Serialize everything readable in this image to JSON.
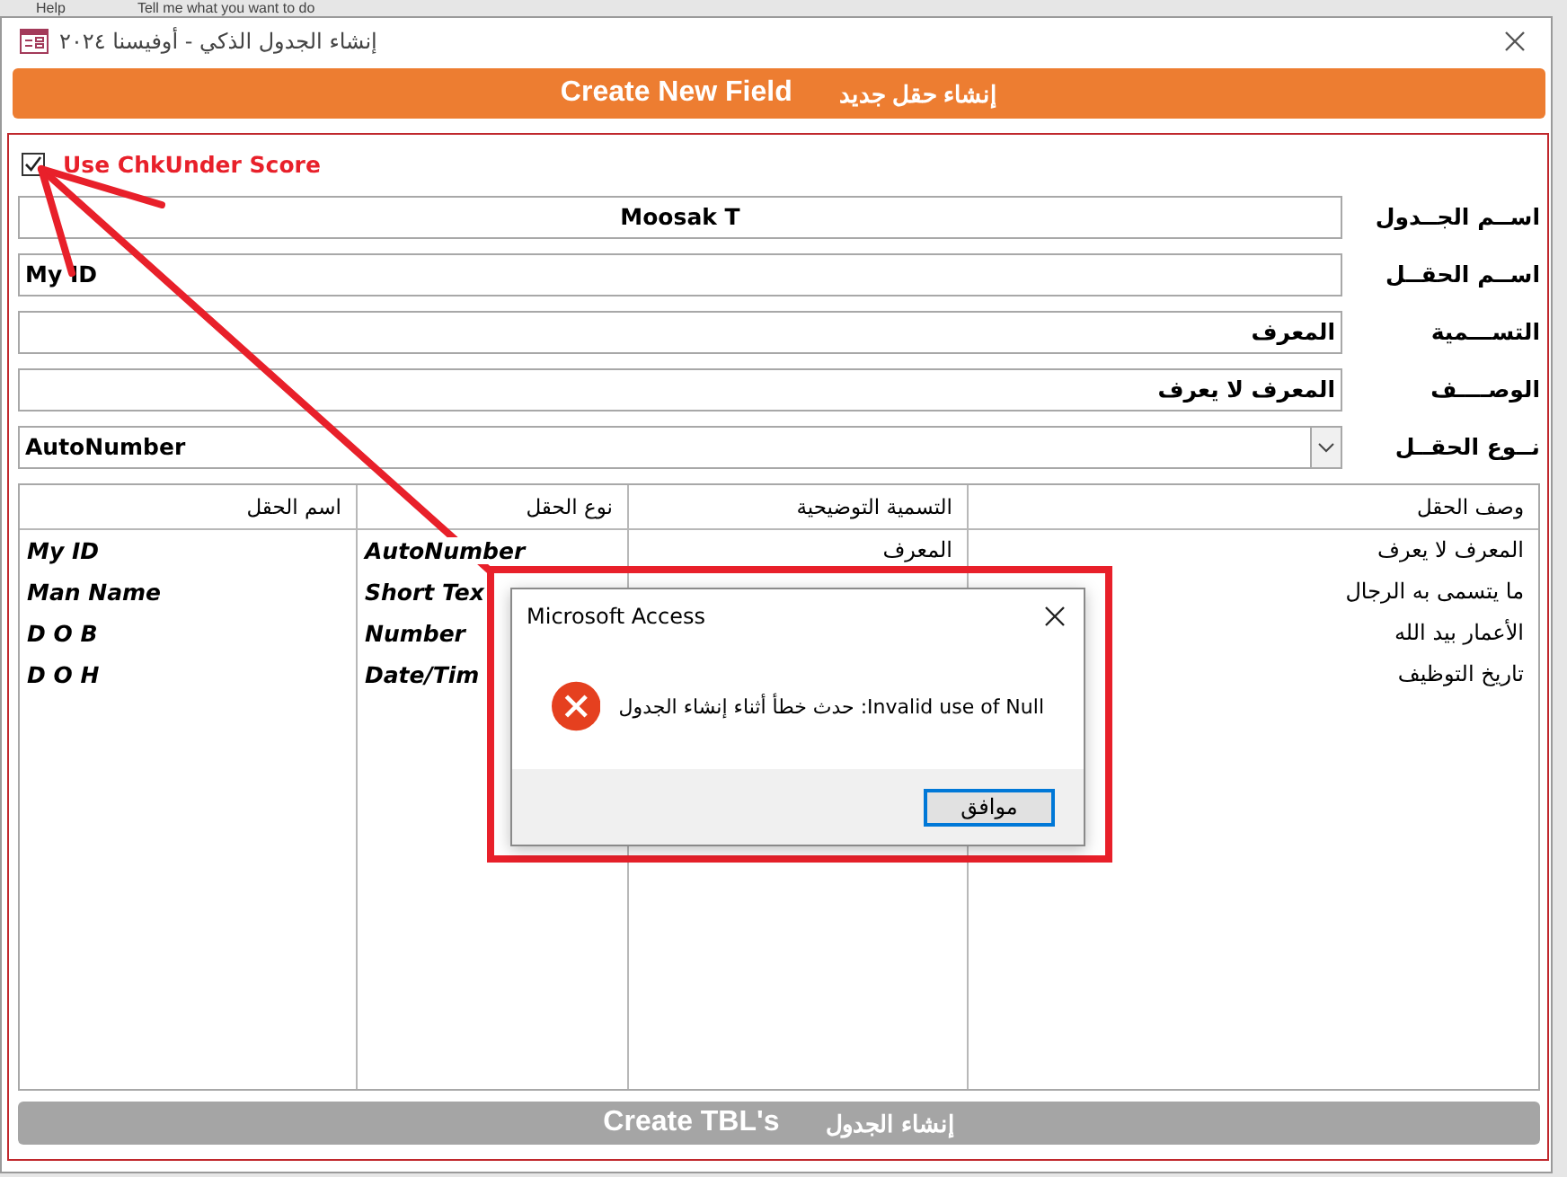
{
  "background_app": {
    "menu_item": "Help",
    "search_hint": "Tell me what you want to do"
  },
  "window": {
    "title": "إنشاء الجدول الذكي - أوفيسنا ٢٠٢٤"
  },
  "create_field_button": {
    "label_en": "Create New Field",
    "label_ar": "إنشاء حقل جديد"
  },
  "use_underscore": {
    "label": "Use ChkUnder Score",
    "checked": true
  },
  "form_fields": [
    {
      "label": "اســم الجــدول",
      "value": "Moosak T",
      "kind": "text"
    },
    {
      "label": "اســم الحقــل",
      "value": "My ID",
      "kind": "text"
    },
    {
      "label": "التســـمية",
      "value": "المعرف",
      "kind": "text"
    },
    {
      "label": "الوصــــف",
      "value": "المعرف لا يعرف",
      "kind": "text"
    },
    {
      "label": "نــوع الحقــل",
      "value": "AutoNumber",
      "kind": "dropdown"
    }
  ],
  "table": {
    "columns": [
      "وصف الحقل",
      "التسمية التوضيحية",
      "نوع الحقل",
      "اسم الحقل"
    ],
    "rows": [
      [
        "المعرف لا يعرف",
        "المعرف",
        "AutoNumber",
        "My ID"
      ],
      [
        "ما يتسمى به الرجال",
        null,
        "Short Tex",
        "Man Name"
      ],
      [
        "الأعمار بيد الله",
        null,
        "Number",
        "D O B"
      ],
      [
        "تاريخ التوظيف",
        null,
        "Date/Tim",
        "D O H"
      ]
    ]
  },
  "create_tables_button": {
    "label_en": "Create TBL's",
    "label_ar": "إنشاء الجدول",
    "disabled": true
  },
  "dialog": {
    "title": "Microsoft Access",
    "message": "حدث خطأ أثناء إنشاء الجدول :Invalid use of Null",
    "button": "موافق"
  }
}
